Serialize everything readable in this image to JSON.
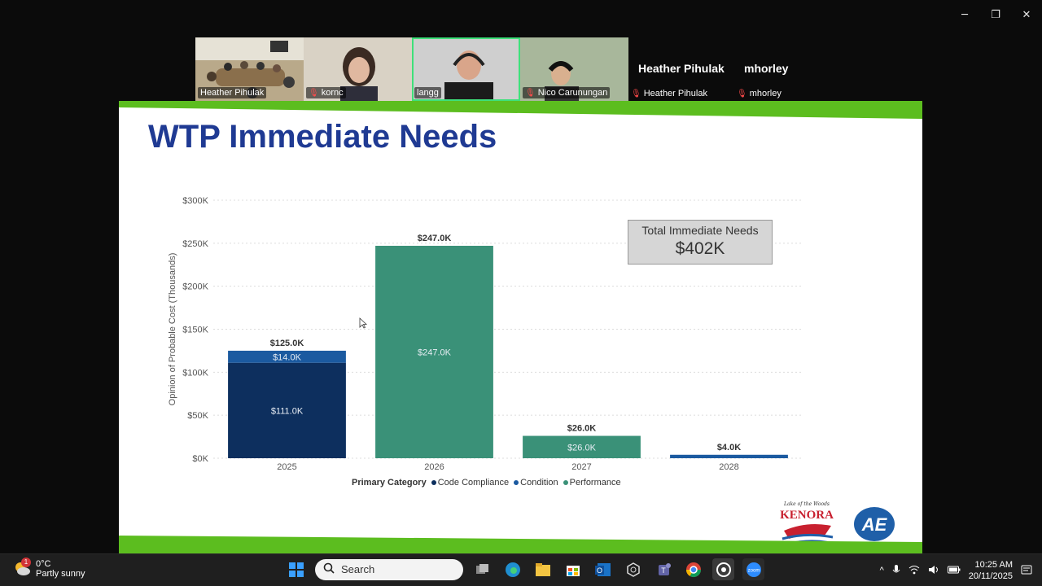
{
  "window": {
    "minimize": "─",
    "restore": "❐",
    "close": "✕"
  },
  "participants": [
    {
      "name": "Heather Pihulak",
      "muted": false
    },
    {
      "name": "kornc",
      "muted": true
    },
    {
      "name": "langg",
      "muted": false,
      "active": true
    },
    {
      "name": "Nico Carunungan",
      "muted": true
    }
  ],
  "text_tiles": [
    {
      "big": "Heather Pihulak",
      "name": "Heather Pihulak"
    },
    {
      "big": "mhorley",
      "name": "mhorley"
    }
  ],
  "slide": {
    "title": "WTP Immediate Needs",
    "total_label": "Total Immediate Needs",
    "total_value": "$402K",
    "accent_green": "#5cbd1f"
  },
  "chart_data": {
    "type": "bar",
    "stacked": true,
    "categories": [
      "2025",
      "2026",
      "2027",
      "2028"
    ],
    "series": [
      {
        "name": "Code Compliance",
        "color": "#0d2f5e",
        "values": [
          111.0,
          0,
          0,
          0
        ],
        "labels": [
          "$111.0K",
          "",
          "",
          ""
        ]
      },
      {
        "name": "Condition",
        "color": "#1b5aa0",
        "values": [
          14.0,
          0,
          0,
          4.0
        ],
        "labels": [
          "$14.0K",
          "",
          "",
          ""
        ]
      },
      {
        "name": "Performance",
        "color": "#3a9178",
        "values": [
          0,
          247.0,
          26.0,
          0
        ],
        "labels": [
          "",
          "$247.0K",
          "$26.0K",
          ""
        ]
      }
    ],
    "totals": [
      "$125.0K",
      "$247.0K",
      "$26.0K",
      "$4.0K"
    ],
    "ylabel": "Opinion of Probable Cost (Thousands)",
    "yticks": [
      "$0K",
      "$50K",
      "$100K",
      "$150K",
      "$200K",
      "$250K",
      "$300K"
    ],
    "ylim": [
      0,
      300
    ],
    "legend_title": "Primary Category",
    "grid": true
  },
  "taskbar": {
    "weather_temp": "0°C",
    "weather_desc": "Partly sunny",
    "weather_badge": "1",
    "search_placeholder": "Search",
    "time": "10:25 AM",
    "date": "20/11/2025"
  }
}
